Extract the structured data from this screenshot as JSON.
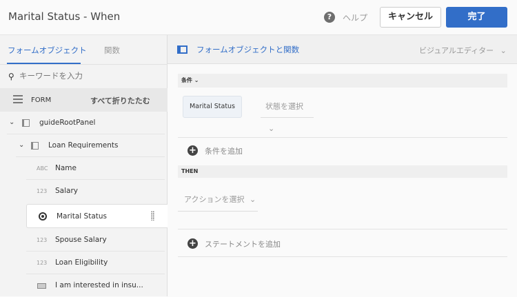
{
  "header": {
    "title": "Marital Status - When",
    "help_label": "ヘルプ",
    "cancel_label": "キャンセル",
    "done_label": "完了"
  },
  "left": {
    "tabs": [
      {
        "label": "フォームオブジェクト"
      },
      {
        "label": "関数"
      }
    ],
    "search_placeholder": "キーワードを入力",
    "form_label": "FORM",
    "collapse_all": "すべて折りたたむ",
    "tree": [
      {
        "label": "guideRootPanel"
      },
      {
        "label": "Loan Requirements"
      },
      {
        "label": "Name",
        "type": "ABC"
      },
      {
        "label": "Salary",
        "type": "123"
      },
      {
        "label": "Marital Status"
      },
      {
        "label": "Spouse Salary",
        "type": "123"
      },
      {
        "label": "Loan Eligibility",
        "type": "123"
      },
      {
        "label": "I am interested in insu..."
      }
    ]
  },
  "right": {
    "title": "フォームオブジェクトと関数",
    "editor_mode": "ビジュアルエディター",
    "condition_header": "条件",
    "condition_field": "Marital Status",
    "state_placeholder": "状態を選択",
    "add_condition": "条件を追加",
    "then_header": "THEN",
    "action_placeholder": "アクションを選択",
    "add_statement": "ステートメントを追加"
  },
  "colors": {
    "accent": "#326ec8"
  }
}
